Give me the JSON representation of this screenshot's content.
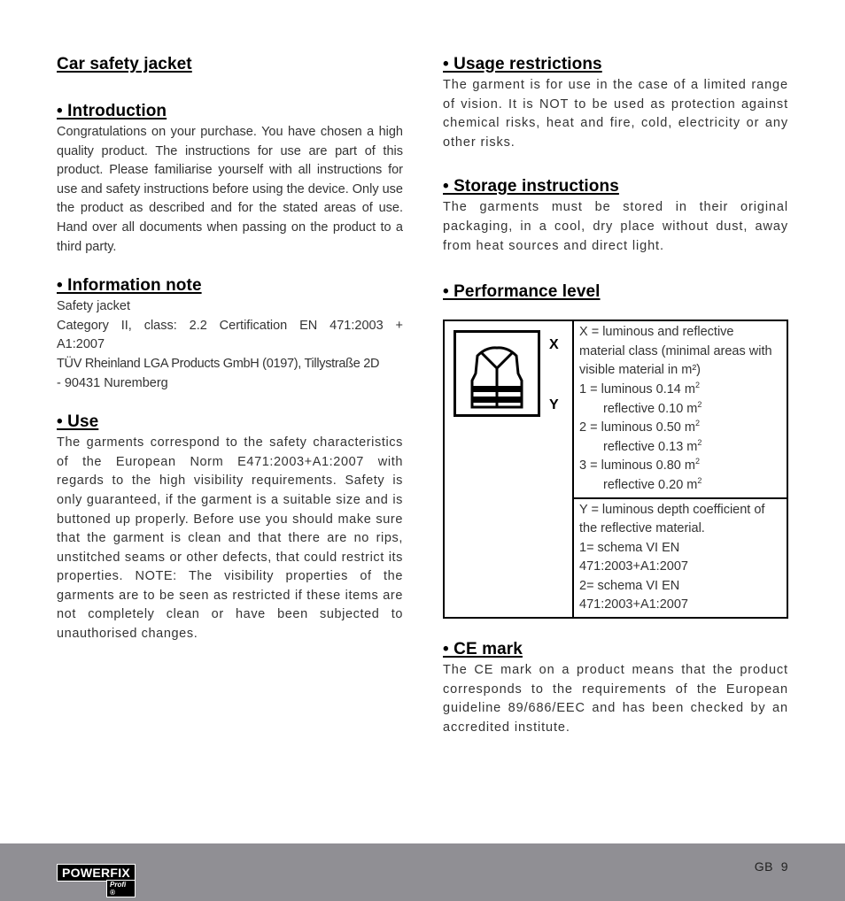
{
  "document_title": "Car safety jacket",
  "left_column": {
    "introduction": {
      "heading": "• Introduction",
      "body": "Congratulations on your purchase. You have chosen a high quality product. The instructions for use are part of this product. Please familiarise yourself with all instructions for use and safety instructions before using the device. Only use the product as described and for the stated areas of use. Hand over all documents when passing on the product to a third party."
    },
    "information_note": {
      "heading": "• Information note",
      "lines": [
        "Safety jacket",
        "Category II, class: 2.2 Certification EN 471:2003 +",
        "A1:2007",
        "TÜV Rheinland LGA Products GmbH (0197), Tillystraße 2D",
        "- 90431 Nuremberg"
      ]
    },
    "use": {
      "heading": "• Use",
      "body": "The garments correspond to the safety characteristics of the European Norm E471:2003+A1:2007 with regards to the high visibility requirements. Safety is only guaranteed, if the garment is a suitable size and is buttoned up properly. Before use you should make sure that the garment is clean and that there are no rips, unstitched seams or other defects, that could restrict its properties. NOTE: The visibility properties of the garments are to be seen as restricted if these items are not completely clean or have been subjected to unauthorised changes."
    }
  },
  "right_column": {
    "usage_restrictions": {
      "heading": "• Usage restrictions",
      "body": "The garment is for use in the case of a limited range of vision. It is NOT to be used as protection against chemical risks, heat and fire, cold, electricity or any other risks."
    },
    "storage_instructions": {
      "heading": "• Storage instructions",
      "body": "The garments must be stored in their original packaging, in a cool, dry place without dust, away from heat sources and direct light."
    },
    "performance_level": {
      "heading": "• Performance level",
      "icon_label_x": "X",
      "icon_label_y": "Y",
      "x_description": "X = luminous and reflective material class (minimal areas with visible material in m²)",
      "x_classes": [
        {
          "prefix": "1 = ",
          "luminous": "luminous 0.14 m",
          "reflective": "reflective 0.10 m"
        },
        {
          "prefix": "2 = ",
          "luminous": "luminous 0.50 m",
          "reflective": "reflective 0.13 m"
        },
        {
          "prefix": "3 = ",
          "luminous": "luminous 0.80 m",
          "reflective": "reflective 0.20 m"
        }
      ],
      "unit_exponent": "2",
      "y_description": "Y = luminous depth coefficient of the reflective material.",
      "y_classes": [
        {
          "line1": "1= schema VI EN",
          "line2": "471:2003+A1:2007"
        },
        {
          "line1": "2= schema VI EN",
          "line2": "471:2003+A1:2007"
        }
      ]
    },
    "ce_mark": {
      "heading": "• CE mark",
      "body": "The CE mark on a product means that the product corresponds to the requirements of the European guideline 89/686/EEC and has been checked by an accredited institute."
    }
  },
  "footer": {
    "brand": "POWERFIX",
    "brand_sub": "Profi ®",
    "page_label": "GB  9",
    "background_color": "#908f94"
  }
}
